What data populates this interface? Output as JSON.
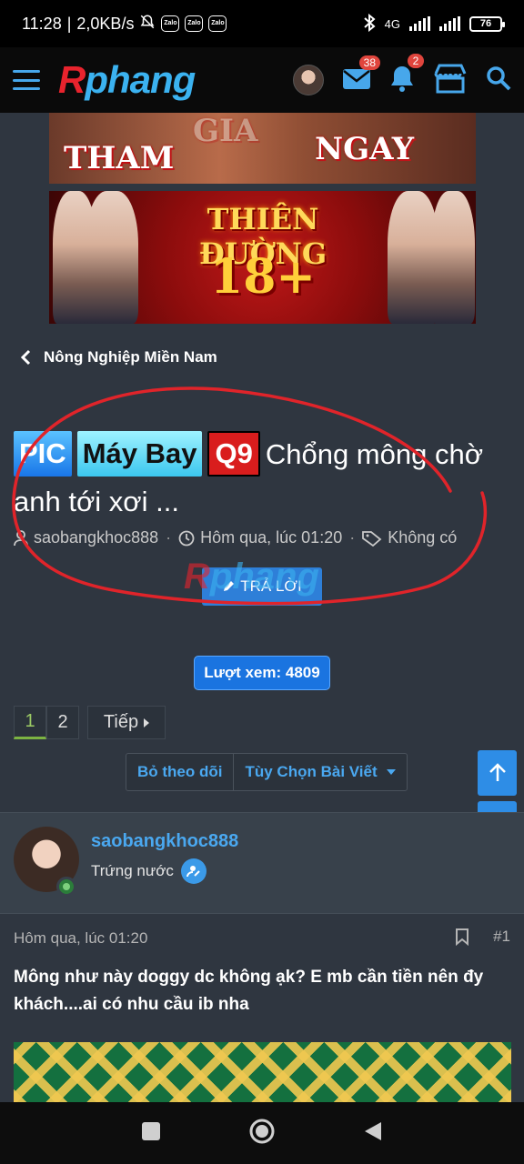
{
  "status_bar": {
    "time": "11:28",
    "speed": "2,0KB/s",
    "zalo_label": "Zalo",
    "network": "4G",
    "battery": "76"
  },
  "header": {
    "logo_r": "R",
    "logo_rest": "phang",
    "messages_badge": "38",
    "alerts_badge": "2",
    "accent_color": "#47a7eb"
  },
  "banners": {
    "banner1_words": [
      "THAM",
      "GIA",
      "NGAY"
    ],
    "banner2_title": "THIÊN ĐƯỜNG",
    "banner2_num": "18+"
  },
  "breadcrumb": {
    "label": "Nông Nghiệp Miền Nam"
  },
  "thread": {
    "prefixes": [
      "PIC",
      "Máy Bay",
      "Q9"
    ],
    "title": "Chổng mông chờ anh tới xơi ...",
    "author": "saobangkhoc888",
    "date": "Hôm qua, lúc 01:20",
    "tags": "Không có",
    "reply_label": "TRẢ LỜI"
  },
  "views": {
    "label": "Lượt xem: 4809"
  },
  "pagination": {
    "pages": [
      "1",
      "2"
    ],
    "current": "1",
    "next_label": "Tiếp"
  },
  "actions": {
    "unwatch": "Bỏ theo dõi",
    "options": "Tùy Chọn Bài Viết"
  },
  "post": {
    "username": "saobangkhoc888",
    "rank": "Trứng nước",
    "date": "Hôm qua, lúc 01:20",
    "number": "#1",
    "body": "Mông như này doggy dc không ạk? E mb cần tiền nên đy khách....ai có nhu cầu ib nha"
  }
}
